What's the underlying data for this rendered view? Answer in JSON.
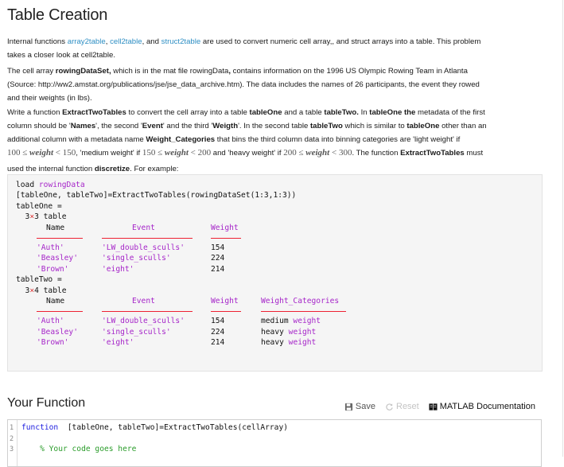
{
  "page": {
    "title": "Table Creation"
  },
  "intro": {
    "p1": {
      "t1": "Internal functions ",
      "link1": "array2table",
      "t2": ", ",
      "link2": "cell2table",
      "t3": ", and ",
      "link3": "struct2table",
      "t4": " are used to convert numeric  cell array,, and struct arrays into a table.  This problem",
      "t5": "takes a closer look at cell2table."
    },
    "p2": {
      "t1": "The cell array ",
      "b1": "rowingDataSet,",
      "t2": " which is in the mat file rowingData",
      "b2": ",",
      "t3": " contains information on the 1996 US Olympic Rowing Team in Atlanta",
      "line2": "(Source: http://ww2.amstat.org/publications/jse/jse_data_archive.htm).  The data includes the names of 26 participants, the event they rowed",
      "line3": "and their weights (in lbs)."
    },
    "p3": {
      "a1": "Write a function ",
      "a2": "ExtractTwoTables",
      "a3": " to convert the cell array into a table ",
      "a4": "tableOne",
      "a5": " and a table ",
      "a6": "tableTwo.",
      "a7": "  In ",
      "a8": "tableOne the",
      "a9": " metadata of the first",
      "b1": "column should be '",
      "b2": "Names",
      "b3": "', the second '",
      "b4": "Event",
      "b5": "' and the third '",
      "b6": "Weigth",
      "b7": "'.   In the second table ",
      "b8": "tableTwo",
      "b9": " which is similar to ",
      "b10": "tableOne",
      "b11": " other than an",
      "c1": "additional column with a metadata name ",
      "c2": "Weight_Categories",
      "c3": " that bins the third column data into binning categories are 'light weight' if",
      "m1a": "100 ≤ ",
      "m1b": "weight",
      "m1c": " < 150",
      "d1": ", 'medium weight' if ",
      "m2a": "150 ≤ ",
      "m2b": "weight",
      "m2c": " < 200",
      "d2": " and 'heavy weight' if ",
      "m3a": "200 ≤ ",
      "m3b": "weight",
      "m3c": " < 300",
      "d3": ".  The function ",
      "d4": "ExtractTwoTables",
      "d5": " must",
      "e1": "used the internal function ",
      "e2": "discretize",
      "e3": ".  For example:"
    }
  },
  "example": {
    "line1_cmd": "load ",
    "line1_arg": "rowingData",
    "line2": "[tableOne, tableTwo]=ExtractTwoTables(rowingDataSet(1:3,1:3))",
    "t1_assign": "tableOne =",
    "t1_size_a": "  3",
    "t1_size_x": "×",
    "t1_size_b": "3 table",
    "t1_headers": [
      "Name",
      "Event",
      "Weight"
    ],
    "t1_rows": [
      [
        "'Auth'",
        "'LW_double_sculls'",
        "154"
      ],
      [
        "'Beasley'",
        "'single_sculls'",
        "224"
      ],
      [
        "'Brown'",
        "'eight'",
        "214"
      ]
    ],
    "t2_assign": "tableTwo =",
    "t2_size_a": "  3",
    "t2_size_x": "×",
    "t2_size_b": "4 table",
    "t2_headers": [
      "Name",
      "Event",
      "Weight",
      "Weight_Categories"
    ],
    "t2_rows": [
      [
        "'Auth'",
        "'LW_double_sculls'",
        "154",
        "medium",
        "weight"
      ],
      [
        "'Beasley'",
        "'single_sculls'",
        "224",
        "heavy",
        "weight"
      ],
      [
        "'Brown'",
        "'eight'",
        "214",
        "heavy",
        "weight"
      ]
    ]
  },
  "function_section": {
    "title": "Your Function",
    "toolbar": {
      "save": "Save",
      "reset": "Reset",
      "docs": "MATLAB Documentation"
    },
    "editor": {
      "lines": [
        {
          "num": "1",
          "kw": "function",
          "rest": "  [tableOne, tableTwo]=ExtractTwoTables(cellArray)"
        },
        {
          "num": "2",
          "kw": "",
          "rest": ""
        },
        {
          "num": "3",
          "comment": "    % Your code goes here"
        }
      ]
    }
  },
  "colors": {
    "link": "#2f8fc4",
    "string_purple": "#a626c9",
    "underline_red": "#e22233",
    "keyword_blue": "#1d1ddf",
    "comment_green": "#2a9c2a"
  }
}
